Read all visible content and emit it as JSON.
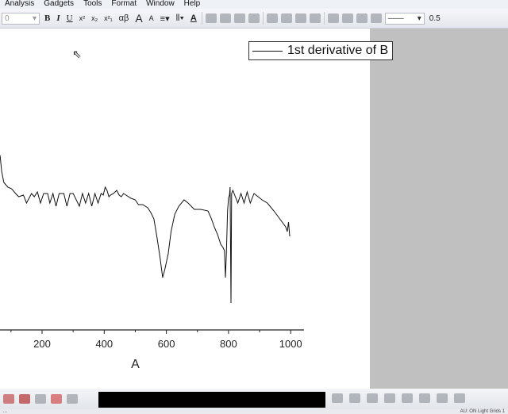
{
  "menu": [
    "Analysis",
    "Gadgets",
    "Tools",
    "Format",
    "Window",
    "Help"
  ],
  "toolbar": {
    "font_size": "0",
    "bold": "B",
    "italic": "I",
    "underline": "U",
    "superscript": "x²",
    "subscript": "x₂",
    "supsub": "x²₁",
    "greek": "αβ",
    "grow": "A",
    "shrink": "A",
    "font_color": "A",
    "line_width": "0.5"
  },
  "status": {
    "left": "...",
    "right": "AU: ON  Light Grids  1"
  },
  "legend": {
    "label": "1st derivative of B"
  },
  "chart_data": {
    "type": "line",
    "title": "",
    "xlabel": "A",
    "ylabel": "",
    "xlim": [
      -30,
      1045
    ],
    "ylim": [
      0,
      210
    ],
    "x_ticks": [
      200,
      400,
      600,
      800,
      1000
    ],
    "series": [
      {
        "name": "1st derivative of B",
        "x": [
          65,
          70,
          77,
          90,
          102,
          115,
          125,
          140,
          150,
          166,
          175,
          185,
          195,
          205,
          218,
          225,
          235,
          245,
          255,
          270,
          280,
          290,
          300,
          320,
          330,
          340,
          350,
          360,
          370,
          380,
          390,
          397,
          403,
          409,
          415,
          420,
          430,
          440,
          448,
          455,
          462,
          470,
          486,
          500,
          510,
          524,
          540,
          550,
          560,
          570,
          580,
          588,
          595,
          606,
          615,
          627,
          640,
          657,
          670,
          690,
          710,
          734,
          745,
          754,
          765,
          775,
          782,
          787,
          790,
          793,
          797,
          800,
          803,
          805,
          808,
          810,
          814,
          818,
          830,
          840,
          850,
          860,
          870,
          882,
          895,
          908,
          925,
          946,
          965,
          984,
          989,
          993,
          997
        ],
        "y": [
          110,
          100,
          93,
          90,
          89,
          86,
          84,
          85,
          80,
          86,
          84,
          87,
          80,
          86,
          86,
          80,
          86,
          78,
          86,
          86,
          78,
          86,
          86,
          78,
          86,
          80,
          86,
          78,
          86,
          80,
          86,
          85,
          90,
          88,
          84,
          85,
          86,
          88,
          85,
          84,
          86,
          85,
          83,
          82,
          79,
          79,
          77,
          74,
          70,
          58,
          45,
          33,
          38,
          48,
          62,
          73,
          78,
          82,
          80,
          76,
          76,
          75,
          70,
          65,
          60,
          54,
          52,
          50,
          33,
          48,
          75,
          83,
          85,
          90,
          17,
          86,
          88,
          86,
          80,
          86,
          80,
          87,
          80,
          86,
          84,
          82,
          80,
          75,
          70,
          65,
          62,
          68,
          59
        ]
      }
    ]
  }
}
